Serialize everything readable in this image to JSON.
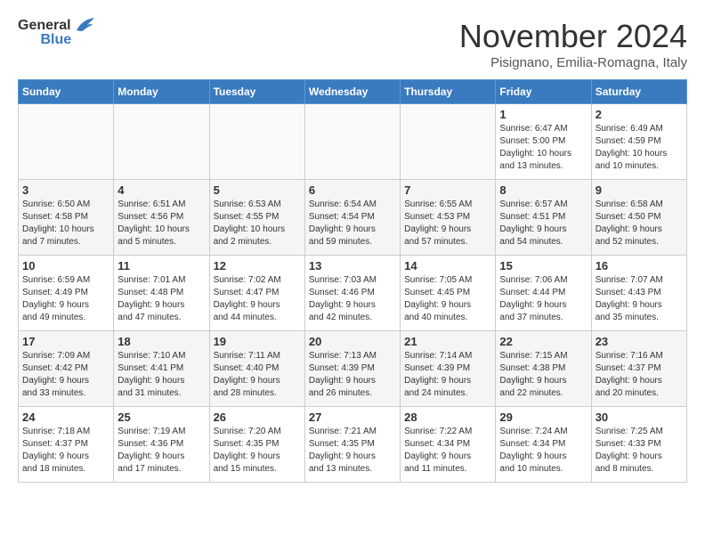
{
  "header": {
    "logo_general": "General",
    "logo_blue": "Blue",
    "title": "November 2024",
    "subtitle": "Pisignano, Emilia-Romagna, Italy"
  },
  "days_of_week": [
    "Sunday",
    "Monday",
    "Tuesday",
    "Wednesday",
    "Thursday",
    "Friday",
    "Saturday"
  ],
  "weeks": [
    [
      {
        "day": "",
        "content": ""
      },
      {
        "day": "",
        "content": ""
      },
      {
        "day": "",
        "content": ""
      },
      {
        "day": "",
        "content": ""
      },
      {
        "day": "",
        "content": ""
      },
      {
        "day": "1",
        "content": "Sunrise: 6:47 AM\nSunset: 5:00 PM\nDaylight: 10 hours\nand 13 minutes."
      },
      {
        "day": "2",
        "content": "Sunrise: 6:49 AM\nSunset: 4:59 PM\nDaylight: 10 hours\nand 10 minutes."
      }
    ],
    [
      {
        "day": "3",
        "content": "Sunrise: 6:50 AM\nSunset: 4:58 PM\nDaylight: 10 hours\nand 7 minutes."
      },
      {
        "day": "4",
        "content": "Sunrise: 6:51 AM\nSunset: 4:56 PM\nDaylight: 10 hours\nand 5 minutes."
      },
      {
        "day": "5",
        "content": "Sunrise: 6:53 AM\nSunset: 4:55 PM\nDaylight: 10 hours\nand 2 minutes."
      },
      {
        "day": "6",
        "content": "Sunrise: 6:54 AM\nSunset: 4:54 PM\nDaylight: 9 hours\nand 59 minutes."
      },
      {
        "day": "7",
        "content": "Sunrise: 6:55 AM\nSunset: 4:53 PM\nDaylight: 9 hours\nand 57 minutes."
      },
      {
        "day": "8",
        "content": "Sunrise: 6:57 AM\nSunset: 4:51 PM\nDaylight: 9 hours\nand 54 minutes."
      },
      {
        "day": "9",
        "content": "Sunrise: 6:58 AM\nSunset: 4:50 PM\nDaylight: 9 hours\nand 52 minutes."
      }
    ],
    [
      {
        "day": "10",
        "content": "Sunrise: 6:59 AM\nSunset: 4:49 PM\nDaylight: 9 hours\nand 49 minutes."
      },
      {
        "day": "11",
        "content": "Sunrise: 7:01 AM\nSunset: 4:48 PM\nDaylight: 9 hours\nand 47 minutes."
      },
      {
        "day": "12",
        "content": "Sunrise: 7:02 AM\nSunset: 4:47 PM\nDaylight: 9 hours\nand 44 minutes."
      },
      {
        "day": "13",
        "content": "Sunrise: 7:03 AM\nSunset: 4:46 PM\nDaylight: 9 hours\nand 42 minutes."
      },
      {
        "day": "14",
        "content": "Sunrise: 7:05 AM\nSunset: 4:45 PM\nDaylight: 9 hours\nand 40 minutes."
      },
      {
        "day": "15",
        "content": "Sunrise: 7:06 AM\nSunset: 4:44 PM\nDaylight: 9 hours\nand 37 minutes."
      },
      {
        "day": "16",
        "content": "Sunrise: 7:07 AM\nSunset: 4:43 PM\nDaylight: 9 hours\nand 35 minutes."
      }
    ],
    [
      {
        "day": "17",
        "content": "Sunrise: 7:09 AM\nSunset: 4:42 PM\nDaylight: 9 hours\nand 33 minutes."
      },
      {
        "day": "18",
        "content": "Sunrise: 7:10 AM\nSunset: 4:41 PM\nDaylight: 9 hours\nand 31 minutes."
      },
      {
        "day": "19",
        "content": "Sunrise: 7:11 AM\nSunset: 4:40 PM\nDaylight: 9 hours\nand 28 minutes."
      },
      {
        "day": "20",
        "content": "Sunrise: 7:13 AM\nSunset: 4:39 PM\nDaylight: 9 hours\nand 26 minutes."
      },
      {
        "day": "21",
        "content": "Sunrise: 7:14 AM\nSunset: 4:39 PM\nDaylight: 9 hours\nand 24 minutes."
      },
      {
        "day": "22",
        "content": "Sunrise: 7:15 AM\nSunset: 4:38 PM\nDaylight: 9 hours\nand 22 minutes."
      },
      {
        "day": "23",
        "content": "Sunrise: 7:16 AM\nSunset: 4:37 PM\nDaylight: 9 hours\nand 20 minutes."
      }
    ],
    [
      {
        "day": "24",
        "content": "Sunrise: 7:18 AM\nSunset: 4:37 PM\nDaylight: 9 hours\nand 18 minutes."
      },
      {
        "day": "25",
        "content": "Sunrise: 7:19 AM\nSunset: 4:36 PM\nDaylight: 9 hours\nand 17 minutes."
      },
      {
        "day": "26",
        "content": "Sunrise: 7:20 AM\nSunset: 4:35 PM\nDaylight: 9 hours\nand 15 minutes."
      },
      {
        "day": "27",
        "content": "Sunrise: 7:21 AM\nSunset: 4:35 PM\nDaylight: 9 hours\nand 13 minutes."
      },
      {
        "day": "28",
        "content": "Sunrise: 7:22 AM\nSunset: 4:34 PM\nDaylight: 9 hours\nand 11 minutes."
      },
      {
        "day": "29",
        "content": "Sunrise: 7:24 AM\nSunset: 4:34 PM\nDaylight: 9 hours\nand 10 minutes."
      },
      {
        "day": "30",
        "content": "Sunrise: 7:25 AM\nSunset: 4:33 PM\nDaylight: 9 hours\nand 8 minutes."
      }
    ]
  ]
}
